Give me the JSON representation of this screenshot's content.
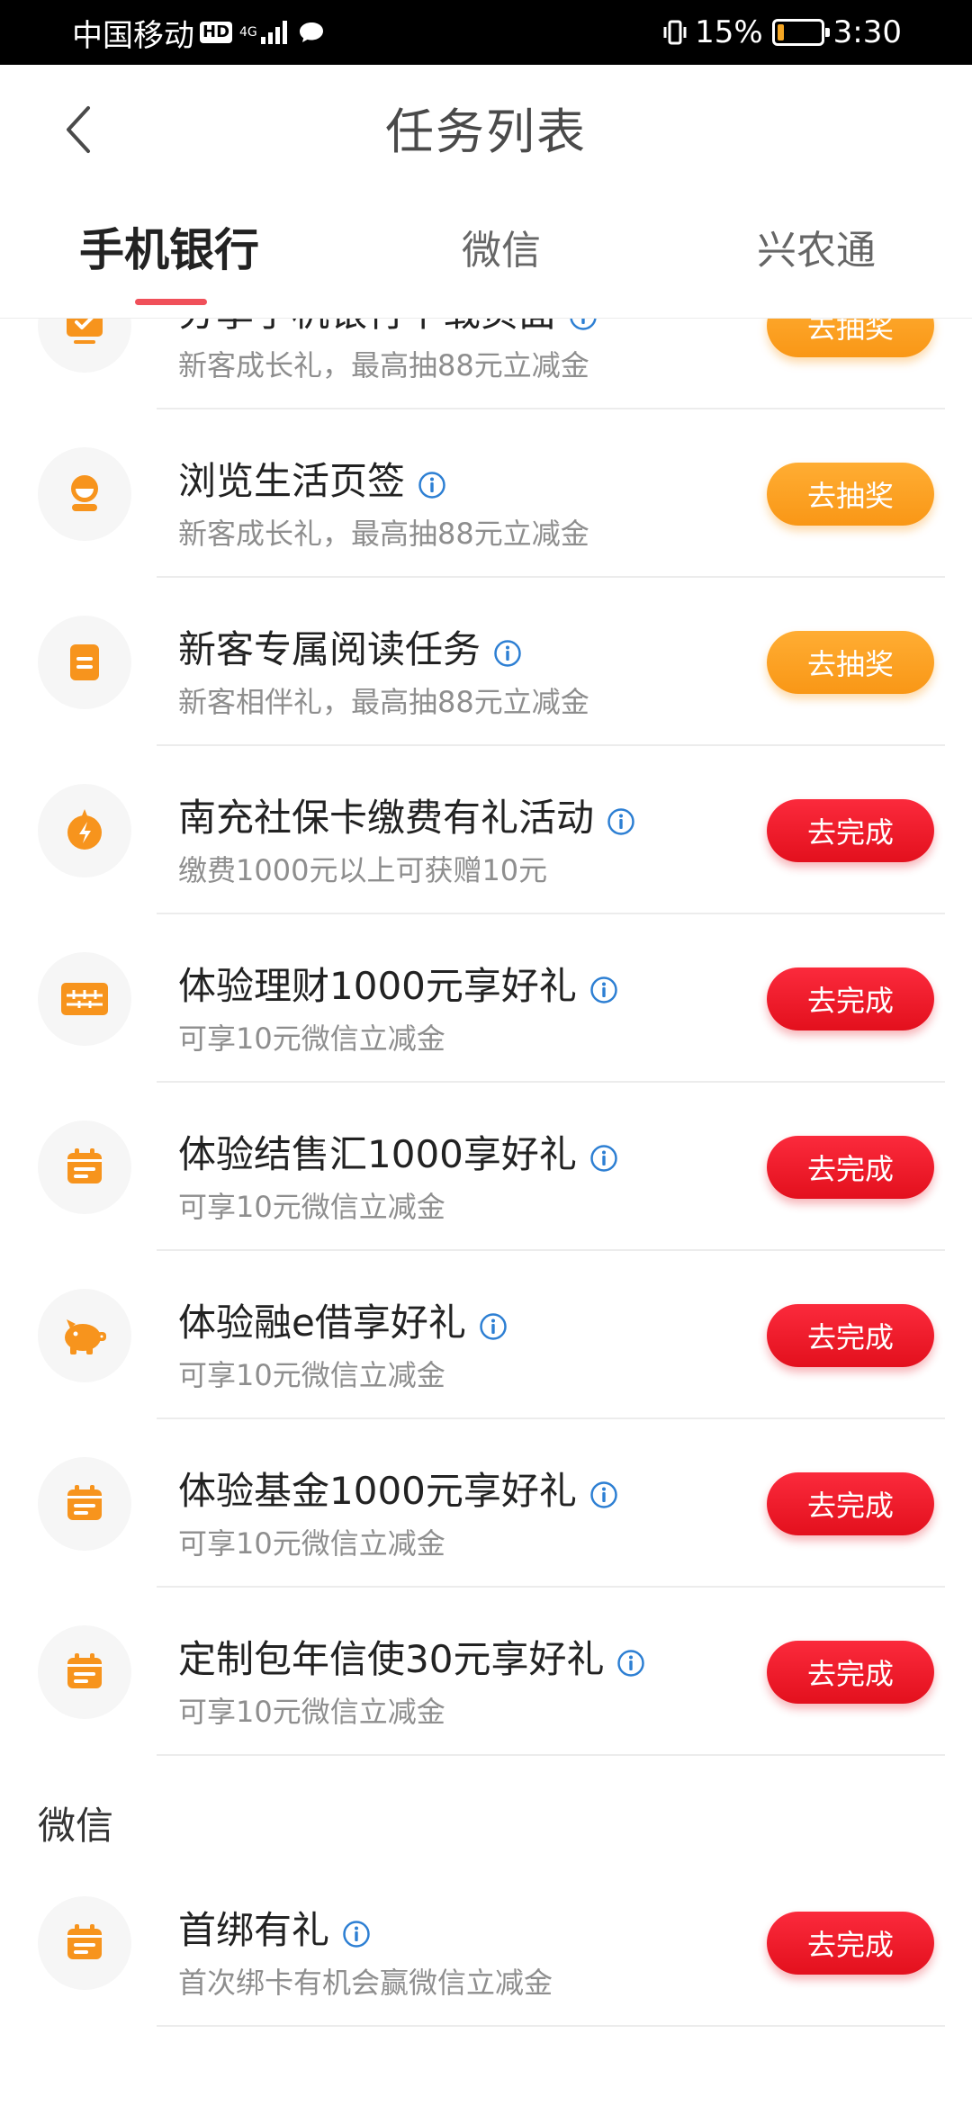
{
  "status_bar": {
    "carrier": "中国移动",
    "hd_badge": "HD",
    "network": "4G",
    "battery": "15%",
    "battery_level": 0.15,
    "time": "3:30"
  },
  "header": {
    "title": "任务列表"
  },
  "tabs": [
    {
      "label": "手机银行",
      "active": true
    },
    {
      "label": "微信",
      "active": false
    },
    {
      "label": "兴农通",
      "active": false
    }
  ],
  "colors": {
    "orange_button": "#f99716",
    "red_button": "#e3101d",
    "icon_orange": "#f7941d",
    "tab_underline": "#f0505a",
    "info_blue": "#2d7fd3"
  },
  "sections": [
    {
      "title": "",
      "tasks": [
        {
          "title": "分享手机银行下载页面",
          "subtitle": "新客成长礼，最高抽88元立减金",
          "button": "去抽奖",
          "button_type": "lottery",
          "icon": "monitor-icon"
        },
        {
          "title": "浏览生活页签",
          "subtitle": "新客成长礼，最高抽88元立减金",
          "button": "去抽奖",
          "button_type": "lottery",
          "icon": "avatar-icon"
        },
        {
          "title": "新客专属阅读任务",
          "subtitle": "新客相伴礼，最高抽88元立减金",
          "button": "去抽奖",
          "button_type": "lottery",
          "icon": "document-icon"
        },
        {
          "title": "南充社保卡缴费有礼活动",
          "subtitle": "缴费1000元以上可获赠10元",
          "button": "去完成",
          "button_type": "complete",
          "icon": "lightning-icon"
        },
        {
          "title": "体验理财1000元享好礼",
          "subtitle": "可享10元微信立减金",
          "button": "去完成",
          "button_type": "complete",
          "icon": "wallet-icon"
        },
        {
          "title": "体验结售汇1000享好礼",
          "subtitle": "可享10元微信立减金",
          "button": "去完成",
          "button_type": "complete",
          "icon": "calendar-icon"
        },
        {
          "title": "体验融e借享好礼",
          "subtitle": "可享10元微信立减金",
          "button": "去完成",
          "button_type": "complete",
          "icon": "piggy-bank-icon"
        },
        {
          "title": "体验基金1000元享好礼",
          "subtitle": "可享10元微信立减金",
          "button": "去完成",
          "button_type": "complete",
          "icon": "calendar-icon"
        },
        {
          "title": "定制包年信使30元享好礼",
          "subtitle": "可享10元微信立减金",
          "button": "去完成",
          "button_type": "complete",
          "icon": "calendar-icon"
        }
      ]
    },
    {
      "title": "微信",
      "tasks": [
        {
          "title": "首绑有礼",
          "subtitle": "首次绑卡有机会赢微信立减金",
          "button": "去完成",
          "button_type": "complete",
          "icon": "calendar-icon"
        }
      ]
    }
  ]
}
